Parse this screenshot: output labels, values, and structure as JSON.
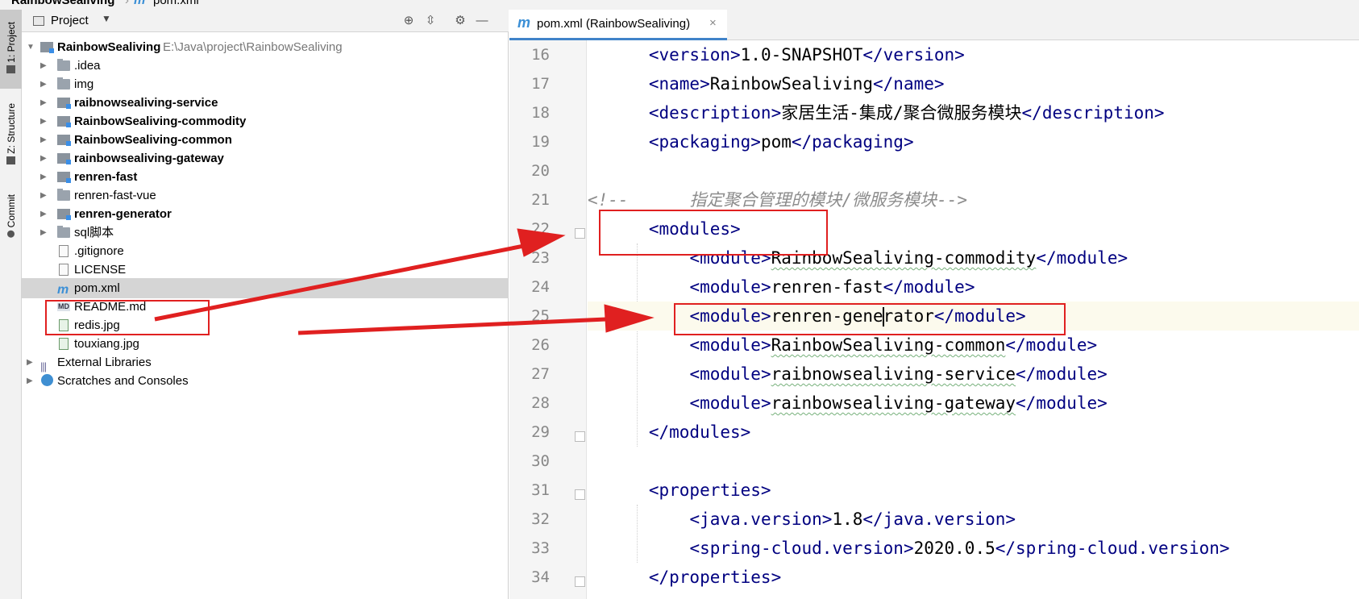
{
  "breadcrumb": {
    "project": "RainbowSealiving",
    "file": "pom.xml",
    "file_icon": "m"
  },
  "tool_strip": {
    "tabs": [
      {
        "label": "1: Project"
      },
      {
        "label": "Z: Structure"
      },
      {
        "label": "Commit"
      }
    ]
  },
  "project_panel": {
    "title": "Project",
    "tree": [
      {
        "label": "RainbowSealiving",
        "path": "E:\\Java\\project\\RainbowSealiving"
      },
      {
        "label": ".idea"
      },
      {
        "label": "img"
      },
      {
        "label": "raibnowsealiving-service"
      },
      {
        "label": "RainbowSealiving-commodity"
      },
      {
        "label": "RainbowSealiving-common"
      },
      {
        "label": "rainbowsealiving-gateway"
      },
      {
        "label": "renren-fast"
      },
      {
        "label": "renren-fast-vue"
      },
      {
        "label": "renren-generator"
      },
      {
        "label": "sql脚本"
      },
      {
        "label": ".gitignore"
      },
      {
        "label": "LICENSE"
      },
      {
        "label": "pom.xml"
      },
      {
        "label": "README.md"
      },
      {
        "label": "redis.jpg"
      },
      {
        "label": "touxiang.jpg"
      },
      {
        "label": "External Libraries"
      },
      {
        "label": "Scratches and Consoles"
      }
    ]
  },
  "editor": {
    "tab_label": "pom.xml (RainbowSealiving)",
    "tab_close": "×",
    "lines": [
      {
        "n": "16",
        "a": "<version>",
        "b": "1.0-SNAPSHOT",
        "c": "</version>"
      },
      {
        "n": "17",
        "a": "<name>",
        "b": "RainbowSealiving",
        "c": "</name>"
      },
      {
        "n": "18",
        "a": "<description>",
        "b": "家居生活-集成/聚合微服务模块",
        "c": "</description>"
      },
      {
        "n": "19",
        "a": "<packaging>",
        "b": "pom",
        "c": "</packaging>"
      },
      {
        "n": "20"
      },
      {
        "n": "21",
        "comment": "<!--      指定聚合管理的模块/微服务模块-->"
      },
      {
        "n": "22",
        "a": "<modules>"
      },
      {
        "n": "23",
        "a": "<module>",
        "b": "RainbowSealiving-commodity",
        "c": "</module>"
      },
      {
        "n": "24",
        "a": "<module>",
        "b": "renren-fast",
        "c": "</module>"
      },
      {
        "n": "25",
        "a": "<module>",
        "b1": "renren-gene",
        "b2": "rator",
        "c": "</module>"
      },
      {
        "n": "26",
        "a": "<module>",
        "b": "RainbowSealiving-common",
        "c": "</module>"
      },
      {
        "n": "27",
        "a": "<module>",
        "b": "raibnowsealiving-service",
        "c": "</module>"
      },
      {
        "n": "28",
        "a": "<module>",
        "b": "rainbowsealiving-gateway",
        "c": "</module>"
      },
      {
        "n": "29",
        "a": "</modules>"
      },
      {
        "n": "30"
      },
      {
        "n": "31",
        "a": "<properties>"
      },
      {
        "n": "32",
        "a": "<java.version>",
        "b": "1.8",
        "c": "</java.version>"
      },
      {
        "n": "33",
        "a": "<spring-cloud.version>",
        "b": "2020.0.5",
        "c": "</spring-cloud.version>"
      },
      {
        "n": "34",
        "a": "</properties>"
      }
    ]
  },
  "colors": {
    "annotation": "#e02020",
    "tag": "#000080",
    "comment": "#8c8c8c",
    "selection": "#d5d5d5",
    "accent": "#4083c9"
  }
}
